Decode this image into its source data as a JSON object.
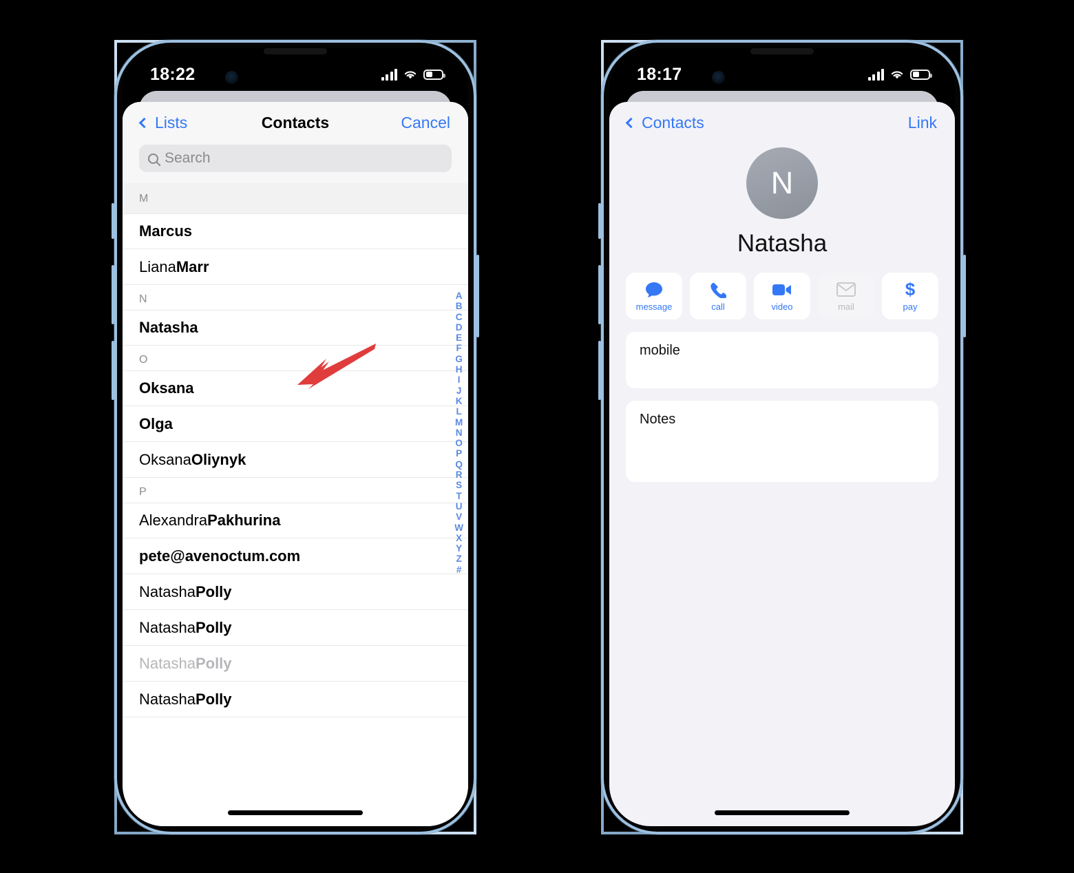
{
  "left_phone": {
    "status": {
      "time": "18:22",
      "signal_icon": "cellular-bars-icon",
      "wifi_icon": "wifi-icon",
      "battery_icon": "battery-icon",
      "battery_level": 42
    },
    "nav": {
      "back_label": "Lists",
      "title": "Contacts",
      "right_label": "Cancel"
    },
    "search": {
      "placeholder": "Search",
      "value": "",
      "icon": "search-icon"
    },
    "sections": [
      {
        "letter": "M",
        "sticky": true,
        "rows": [
          {
            "first": "",
            "last": "Marcus",
            "dim": false
          },
          {
            "first": "Liana ",
            "last": "Marr",
            "dim": false
          }
        ]
      },
      {
        "letter": "N",
        "sticky": false,
        "rows": [
          {
            "first": "",
            "last": "Natasha",
            "dim": false
          }
        ]
      },
      {
        "letter": "O",
        "sticky": false,
        "rows": [
          {
            "first": "",
            "last": "Oksana",
            "dim": false
          },
          {
            "first": "",
            "last": "Olga",
            "dim": false
          },
          {
            "first": "Oksana ",
            "last": "Oliynyk",
            "dim": false
          }
        ]
      },
      {
        "letter": "P",
        "sticky": false,
        "rows": [
          {
            "first": "Alexandra ",
            "last": "Pakhurina",
            "dim": false
          },
          {
            "first": "",
            "last": "pete@avenoctum.com",
            "dim": false
          },
          {
            "first": "Natasha ",
            "last": "Polly",
            "dim": false
          },
          {
            "first": "Natasha ",
            "last": "Polly",
            "dim": false
          },
          {
            "first": "Natasha ",
            "last": "Polly",
            "dim": true
          },
          {
            "first": "Natasha ",
            "last": "Polly",
            "dim": false
          }
        ]
      }
    ],
    "alpha_index": [
      "A",
      "B",
      "C",
      "D",
      "E",
      "F",
      "G",
      "H",
      "I",
      "J",
      "K",
      "L",
      "M",
      "N",
      "O",
      "P",
      "Q",
      "R",
      "S",
      "T",
      "U",
      "V",
      "W",
      "X",
      "Y",
      "Z",
      "#"
    ]
  },
  "right_phone": {
    "status": {
      "time": "18:17",
      "signal_icon": "cellular-bars-icon",
      "wifi_icon": "wifi-icon",
      "battery_icon": "battery-icon",
      "battery_level": 42
    },
    "nav": {
      "back_label": "Contacts",
      "right_label": "Link"
    },
    "contact": {
      "initial": "N",
      "name": "Natasha"
    },
    "actions": [
      {
        "label": "message",
        "icon": "message-bubble-icon",
        "enabled": true
      },
      {
        "label": "call",
        "icon": "phone-icon",
        "enabled": true
      },
      {
        "label": "video",
        "icon": "video-camera-icon",
        "enabled": true
      },
      {
        "label": "mail",
        "icon": "envelope-icon",
        "enabled": false
      },
      {
        "label": "pay",
        "icon": "dollar-sign-icon",
        "enabled": true
      }
    ],
    "cards": [
      {
        "label": "mobile",
        "value": ""
      },
      {
        "label": "Notes",
        "value": ""
      }
    ]
  },
  "annotations": {
    "arrow_color": "#e03c3c",
    "arrow_1_target": "Natasha",
    "arrow_2_target": "Link"
  },
  "colors": {
    "accent_blue": "#3478f6",
    "index_blue": "#5b8ae0",
    "bg_grey": "#f2f2f7",
    "frame_blue": "#9dc0e0",
    "dim_text": "#b6b6ba"
  }
}
